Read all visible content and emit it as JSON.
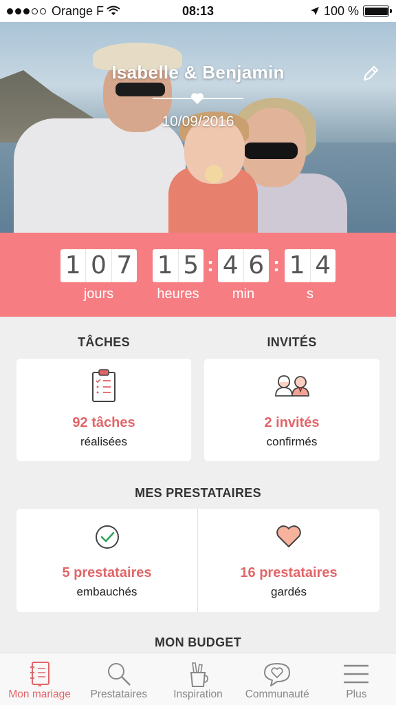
{
  "status_bar": {
    "carrier": "Orange F",
    "time": "08:13",
    "battery": "100 %",
    "icons": [
      "signal-dots",
      "wifi-icon",
      "location-arrow-icon",
      "battery-icon"
    ]
  },
  "hero": {
    "title": "Isabelle & Benjamin",
    "date": "10/09/2016",
    "icons": [
      "heart-icon",
      "pencil-edit-icon"
    ]
  },
  "countdown": {
    "days": [
      "1",
      "0",
      "7"
    ],
    "hours": [
      "1",
      "5"
    ],
    "minutes": [
      "4",
      "6"
    ],
    "seconds": [
      "1",
      "4"
    ],
    "separator": ":",
    "labels": {
      "days": "jours",
      "hours": "heures",
      "minutes": "min",
      "seconds": "s"
    },
    "accent_color": "#f67d82"
  },
  "sections": {
    "tasks": {
      "title": "TÂCHES",
      "count": "92 tâches",
      "caption": "réalisées",
      "icon": "clipboard-checklist-icon"
    },
    "guests": {
      "title": "INVITÉS",
      "count": "2 invités",
      "caption": "confirmés",
      "icon": "couple-people-icon"
    },
    "vendors": {
      "title": "MES PRESTATAIRES",
      "hired": {
        "count": "5 prestataires",
        "caption": "embauchés",
        "icon": "check-circle-icon"
      },
      "saved": {
        "count": "16 prestataires",
        "caption": "gardés",
        "icon": "heart-icon"
      }
    },
    "budget": {
      "title": "MON BUDGET"
    }
  },
  "tab_bar": {
    "items": [
      {
        "label": "Mon mariage",
        "icon": "notebook-icon",
        "active": true
      },
      {
        "label": "Prestataires",
        "icon": "search-icon",
        "active": false
      },
      {
        "label": "Inspiration",
        "icon": "pencil-cup-icon",
        "active": false
      },
      {
        "label": "Communauté",
        "icon": "chat-heart-icon",
        "active": false
      },
      {
        "label": "Plus",
        "icon": "menu-icon",
        "active": false
      }
    ],
    "active_color": "#e16568"
  }
}
